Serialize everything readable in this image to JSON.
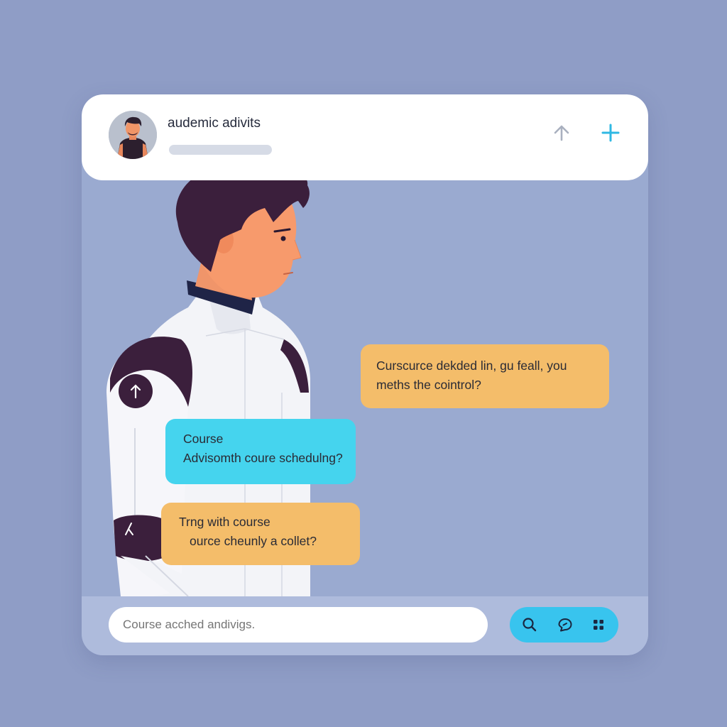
{
  "header": {
    "title": "audemic adivits",
    "upload_icon": "arrow-up-icon",
    "add_icon": "plus-icon"
  },
  "messages": [
    {
      "sender": "advisor",
      "lines": [
        "Curscurce dekded lin, gu feall, you",
        "meths the cointrol?"
      ],
      "color": "#f4bd6a"
    },
    {
      "sender": "user",
      "lines": [
        "Course",
        "Advisomth coure schedulng?"
      ],
      "color": "#45d4ee"
    },
    {
      "sender": "user",
      "lines": [
        "Trng with course",
        "ource cheunly a collet?"
      ],
      "color": "#f4bd6a"
    }
  ],
  "composer": {
    "placeholder": "Course acched andivigs.",
    "actions": [
      "search-icon",
      "chat-icon",
      "apps-grid-icon"
    ]
  },
  "colors": {
    "background": "#8f9dc6",
    "accent_blue": "#38c4ee",
    "accent_orange": "#f4bd6a",
    "dark_purple": "#3b1f3c"
  }
}
